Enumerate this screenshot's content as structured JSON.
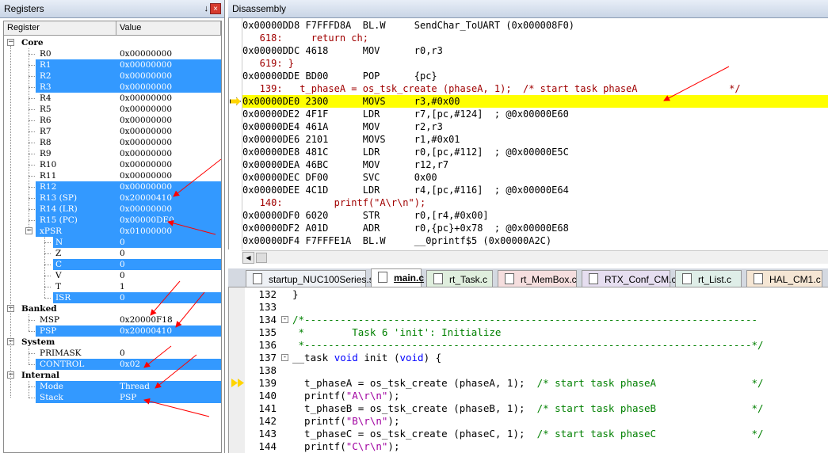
{
  "registers_panel": {
    "title": "Registers",
    "pin_label": "↓",
    "close_label": "×",
    "col_register": "Register",
    "col_value": "Value",
    "core": {
      "label": "Core",
      "rows": [
        {
          "name": "R0",
          "value": "0x00000000",
          "selected": false
        },
        {
          "name": "R1",
          "value": "0x00000000",
          "selected": true
        },
        {
          "name": "R2",
          "value": "0x00000000",
          "selected": true
        },
        {
          "name": "R3",
          "value": "0x00000000",
          "selected": true
        },
        {
          "name": "R4",
          "value": "0x00000000",
          "selected": false
        },
        {
          "name": "R5",
          "value": "0x00000000",
          "selected": false
        },
        {
          "name": "R6",
          "value": "0x00000000",
          "selected": false
        },
        {
          "name": "R7",
          "value": "0x00000000",
          "selected": false
        },
        {
          "name": "R8",
          "value": "0x00000000",
          "selected": false
        },
        {
          "name": "R9",
          "value": "0x00000000",
          "selected": false
        },
        {
          "name": "R10",
          "value": "0x00000000",
          "selected": false
        },
        {
          "name": "R11",
          "value": "0x00000000",
          "selected": false
        },
        {
          "name": "R12",
          "value": "0x00000000",
          "selected": true
        },
        {
          "name": "R13 (SP)",
          "value": "0x20000410",
          "selected": true
        },
        {
          "name": "R14 (LR)",
          "value": "0x00000000",
          "selected": true
        },
        {
          "name": "R15 (PC)",
          "value": "0x00000DE0",
          "selected": true
        }
      ],
      "xpsr": {
        "name": "xPSR",
        "value": "0x01000000",
        "selected": true,
        "flags": [
          {
            "name": "N",
            "value": "0",
            "selected": true
          },
          {
            "name": "Z",
            "value": "0",
            "selected": false
          },
          {
            "name": "C",
            "value": "0",
            "selected": true
          },
          {
            "name": "V",
            "value": "0",
            "selected": false
          },
          {
            "name": "T",
            "value": "1",
            "selected": false
          },
          {
            "name": "ISR",
            "value": "0",
            "selected": true
          }
        ]
      }
    },
    "banked": {
      "label": "Banked",
      "rows": [
        {
          "name": "MSP",
          "value": "0x20000F18",
          "selected": false
        },
        {
          "name": "PSP",
          "value": "0x20000410",
          "selected": true
        }
      ]
    },
    "system": {
      "label": "System",
      "rows": [
        {
          "name": "PRIMASK",
          "value": "0",
          "selected": false
        },
        {
          "name": "CONTROL",
          "value": "0x02",
          "selected": true
        }
      ]
    },
    "internal": {
      "label": "Internal",
      "rows": [
        {
          "name": "Mode",
          "value": "Thread",
          "selected": true
        },
        {
          "name": "Stack",
          "value": "PSP",
          "selected": true
        }
      ]
    }
  },
  "disassembly": {
    "title": "Disassembly",
    "lines": [
      {
        "text": "0x00000DD8 F7FFFD8A  BL.W     SendChar_ToUART (0x000008F0)",
        "kind": "asm"
      },
      {
        "text": "   618:     return ch;",
        "kind": "src"
      },
      {
        "text": "0x00000DDC 4618      MOV      r0,r3",
        "kind": "asm"
      },
      {
        "text": "   619: }",
        "kind": "src"
      },
      {
        "text": "0x00000DDE BD00      POP      {pc}",
        "kind": "asm"
      },
      {
        "text": "   139:   t_phaseA = os_tsk_create (phaseA, 1);  /* start task phaseA                */",
        "kind": "src"
      },
      {
        "text": "0x00000DE0 2300      MOVS     r3,#0x00",
        "kind": "cur"
      },
      {
        "text": "0x00000DE2 4F1F      LDR      r7,[pc,#124]  ; @0x00000E60",
        "kind": "asm"
      },
      {
        "text": "0x00000DE4 461A      MOV      r2,r3",
        "kind": "asm"
      },
      {
        "text": "0x00000DE6 2101      MOVS     r1,#0x01",
        "kind": "asm"
      },
      {
        "text": "0x00000DE8 481C      LDR      r0,[pc,#112]  ; @0x00000E5C",
        "kind": "asm"
      },
      {
        "text": "0x00000DEA 46BC      MOV      r12,r7",
        "kind": "asm"
      },
      {
        "text": "0x00000DEC DF00      SVC      0x00",
        "kind": "asm"
      },
      {
        "text": "0x00000DEE 4C1D      LDR      r4,[pc,#116]  ; @0x00000E64",
        "kind": "asm"
      },
      {
        "text": "   140:         printf(\"A\\r\\n\");",
        "kind": "src"
      },
      {
        "text": "0x00000DF0 6020      STR      r0,[r4,#0x00]",
        "kind": "asm"
      },
      {
        "text": "0x00000DF2 A01D      ADR      r0,{pc}+0x78  ; @0x00000E68",
        "kind": "asm"
      },
      {
        "text": "0x00000DF4 F7FFFE1A  BL.W     __0printf$5 (0x00000A2C)",
        "kind": "asm"
      }
    ]
  },
  "tabs": [
    {
      "label": "startup_NUC100Series.s",
      "active": false,
      "color": "#eef1f5"
    },
    {
      "label": "main.c",
      "active": true,
      "color": "#ffffff"
    },
    {
      "label": "rt_Task.c",
      "active": false,
      "color": "#dfeedd"
    },
    {
      "label": "rt_MemBox.c",
      "active": false,
      "color": "#f5dede"
    },
    {
      "label": "RTX_Conf_CM.c",
      "active": false,
      "color": "#e6def0"
    },
    {
      "label": "rt_List.c",
      "active": false,
      "color": "#dfeee8"
    },
    {
      "label": "HAL_CM1.c",
      "active": false,
      "color": "#f5e6d4"
    }
  ],
  "editor": {
    "lines": [
      {
        "num": "132",
        "fold": "",
        "html": "}"
      },
      {
        "num": "133",
        "fold": "",
        "html": ""
      },
      {
        "num": "134",
        "fold": "-",
        "html": "<span class='cm'>/*----------------------------------------------------------------------------</span>"
      },
      {
        "num": "135",
        "fold": "",
        "html": "<span class='cm'> *        Task 6 'init': Initialize</span>"
      },
      {
        "num": "136",
        "fold": "",
        "html": "<span class='cm'> *---------------------------------------------------------------------------*/</span>"
      },
      {
        "num": "137",
        "fold": "-",
        "html": "__task <span class='kw'>void</span> init (<span class='kw'>void</span>) {"
      },
      {
        "num": "138",
        "fold": "",
        "html": ""
      },
      {
        "num": "139",
        "fold": "",
        "html": "  t_phaseA = os_tsk_create (phaseA, 1);  <span class='cm'>/* start task phaseA                */</span>",
        "marker": true
      },
      {
        "num": "140",
        "fold": "",
        "html": "  printf(<span class='st'>\"A\\r\\n\"</span>);"
      },
      {
        "num": "141",
        "fold": "",
        "html": "  t_phaseB = os_tsk_create (phaseB, 1);  <span class='cm'>/* start task phaseB                */</span>"
      },
      {
        "num": "142",
        "fold": "",
        "html": "  printf(<span class='st'>\"B\\r\\n\"</span>);"
      },
      {
        "num": "143",
        "fold": "",
        "html": "  t_phaseC = os_tsk_create (phaseC, 1);  <span class='cm'>/* start task phaseC                */</span>"
      },
      {
        "num": "144",
        "fold": "",
        "html": "  printf(<span class='st'>\"C\\r\\n\"</span>);"
      }
    ]
  },
  "colors": {
    "selection": "#3399ff",
    "current_line": "#ffff00",
    "annotation_arrow": "#ff0000"
  }
}
